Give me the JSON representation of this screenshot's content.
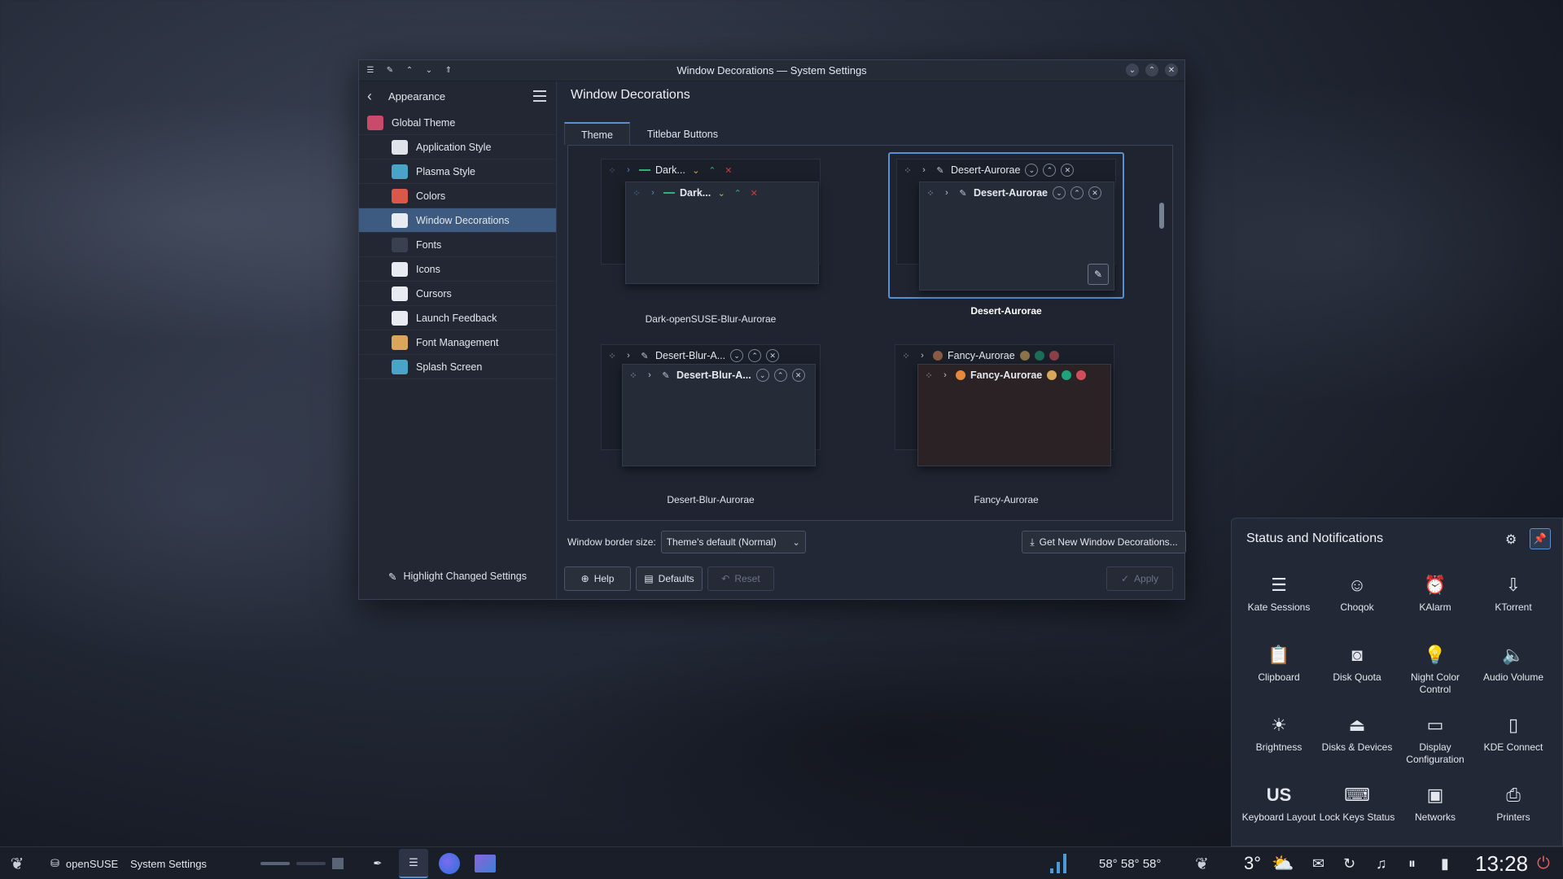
{
  "window": {
    "title": "Window Decorations — System Settings"
  },
  "sidebar": {
    "header": "Appearance",
    "items": [
      {
        "label": "Global Theme",
        "icon": "global-theme-icon",
        "color": "#c94a6b"
      },
      {
        "label": "Application Style",
        "icon": "application-style-icon",
        "color": "#e0e4ea"
      },
      {
        "label": "Plasma Style",
        "icon": "plasma-style-icon",
        "color": "#4aa3c9"
      },
      {
        "label": "Colors",
        "icon": "colors-icon",
        "color": "#d9584b"
      },
      {
        "label": "Window Decorations",
        "icon": "window-decorations-icon",
        "color": "#e8ecf2"
      },
      {
        "label": "Fonts",
        "icon": "fonts-icon",
        "color": "#3a4050"
      },
      {
        "label": "Icons",
        "icon": "icons-icon",
        "color": "#e8ecf2"
      },
      {
        "label": "Cursors",
        "icon": "cursors-icon",
        "color": "#e8ecf2"
      },
      {
        "label": "Launch Feedback",
        "icon": "launch-feedback-icon",
        "color": "#e8ecf2"
      },
      {
        "label": "Font Management",
        "icon": "font-management-icon",
        "color": "#d9a65b"
      },
      {
        "label": "Splash Screen",
        "icon": "splash-screen-icon",
        "color": "#4aa3c9"
      }
    ],
    "selected_index": 4,
    "footer": "Highlight Changed Settings"
  },
  "content": {
    "title": "Window Decorations",
    "tabs": [
      "Theme",
      "Titlebar Buttons"
    ],
    "active_tab": 0,
    "themes": [
      {
        "name": "Dark-openSUSE-Blur-Aurorae",
        "title_text": "Dark...",
        "selected": false
      },
      {
        "name": "Desert-Aurorae",
        "title_text": "Desert-Aurorae",
        "selected": true
      },
      {
        "name": "Desert-Blur-Aurorae",
        "title_text": "Desert-Blur-A...",
        "selected": false
      },
      {
        "name": "Fancy-Aurorae",
        "title_text": "Fancy-Aurorae",
        "selected": false
      }
    ],
    "border_size_label": "Window border size:",
    "border_size_value": "Theme's default (Normal)",
    "get_new_label": "Get New Window Decorations...",
    "help_label": "Help",
    "defaults_label": "Defaults",
    "reset_label": "Reset",
    "apply_label": "Apply"
  },
  "status_popup": {
    "title": "Status and Notifications",
    "items": [
      {
        "label": "Kate Sessions",
        "icon": "kate-sessions-icon"
      },
      {
        "label": "Choqok",
        "icon": "choqok-icon"
      },
      {
        "label": "KAlarm",
        "icon": "kalarm-icon"
      },
      {
        "label": "KTorrent",
        "icon": "ktorrent-icon"
      },
      {
        "label": "Clipboard",
        "icon": "clipboard-icon"
      },
      {
        "label": "Disk Quota",
        "icon": "disk-quota-icon"
      },
      {
        "label": "Night Color Control",
        "icon": "night-color-icon"
      },
      {
        "label": "Audio Volume",
        "icon": "audio-volume-icon"
      },
      {
        "label": "Brightness",
        "icon": "brightness-icon"
      },
      {
        "label": "Disks & Devices",
        "icon": "disks-devices-icon"
      },
      {
        "label": "Display Configuration",
        "icon": "display-configuration-icon"
      },
      {
        "label": "KDE Connect",
        "icon": "kde-connect-icon"
      },
      {
        "label": "Keyboard Layout",
        "icon": "keyboard-layout-icon",
        "icon_text": "US"
      },
      {
        "label": "Lock Keys Status",
        "icon": "lock-keys-icon"
      },
      {
        "label": "Networks",
        "icon": "networks-icon"
      },
      {
        "label": "Printers",
        "icon": "printers-icon"
      }
    ]
  },
  "taskbar": {
    "opensuse_label": "openSUSE",
    "system_settings_label": "System Settings",
    "sensors_text": "58° 58° 58°",
    "weather_temp": "3°",
    "clock": "13:28"
  },
  "colors": {
    "accent": "#5a8fd0",
    "selected_bg": "#3d5a80",
    "window_bg": "#232836",
    "fancy_orange": "#e8893a",
    "fancy_yellow": "#d8a95a",
    "fancy_green": "#1fa37d",
    "fancy_red": "#d0505a",
    "dark_red": "#d03a3a",
    "dark_green": "#2bb37a",
    "dark_yellow": "#d8b23a"
  }
}
